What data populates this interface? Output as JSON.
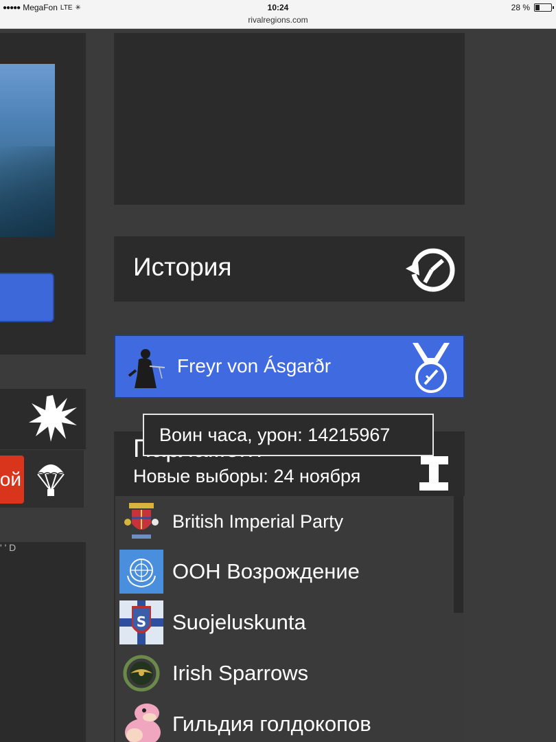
{
  "status_bar": {
    "carrier": "MegaFon",
    "network": "LTE",
    "time": "10:24",
    "url": "rivalregions.com",
    "battery": "28 %",
    "battery_level_percent": 28
  },
  "left_column": {
    "red_button_label": "ой",
    "fragment_text": "' ' D"
  },
  "history": {
    "title": "История"
  },
  "warrior_of_hour": {
    "name": "Freyr von Ásgarðr"
  },
  "tooltip": {
    "text": "Воин часа, урон: 14215967"
  },
  "parliament": {
    "title": "Парламент",
    "next_elections": "Новые выборы: 24 ноября"
  },
  "parties": [
    {
      "name": "British Imperial Party",
      "emblem": "royal-crest-icon"
    },
    {
      "name": "ООН Возрождение",
      "emblem": "un-emblem-icon"
    },
    {
      "name": "Suojeluskunta",
      "emblem": "s-shield-icon"
    },
    {
      "name": "Irish Sparrows",
      "emblem": "sparrow-wreath-icon"
    },
    {
      "name": "Гильдия голдокопов",
      "emblem": "pink-creature-icon"
    }
  ],
  "colors": {
    "accent_blue": "#3f6ae0",
    "alert_red": "#d9351c",
    "panel_dark": "#2b2b2b",
    "background": "#3b3b3b"
  }
}
